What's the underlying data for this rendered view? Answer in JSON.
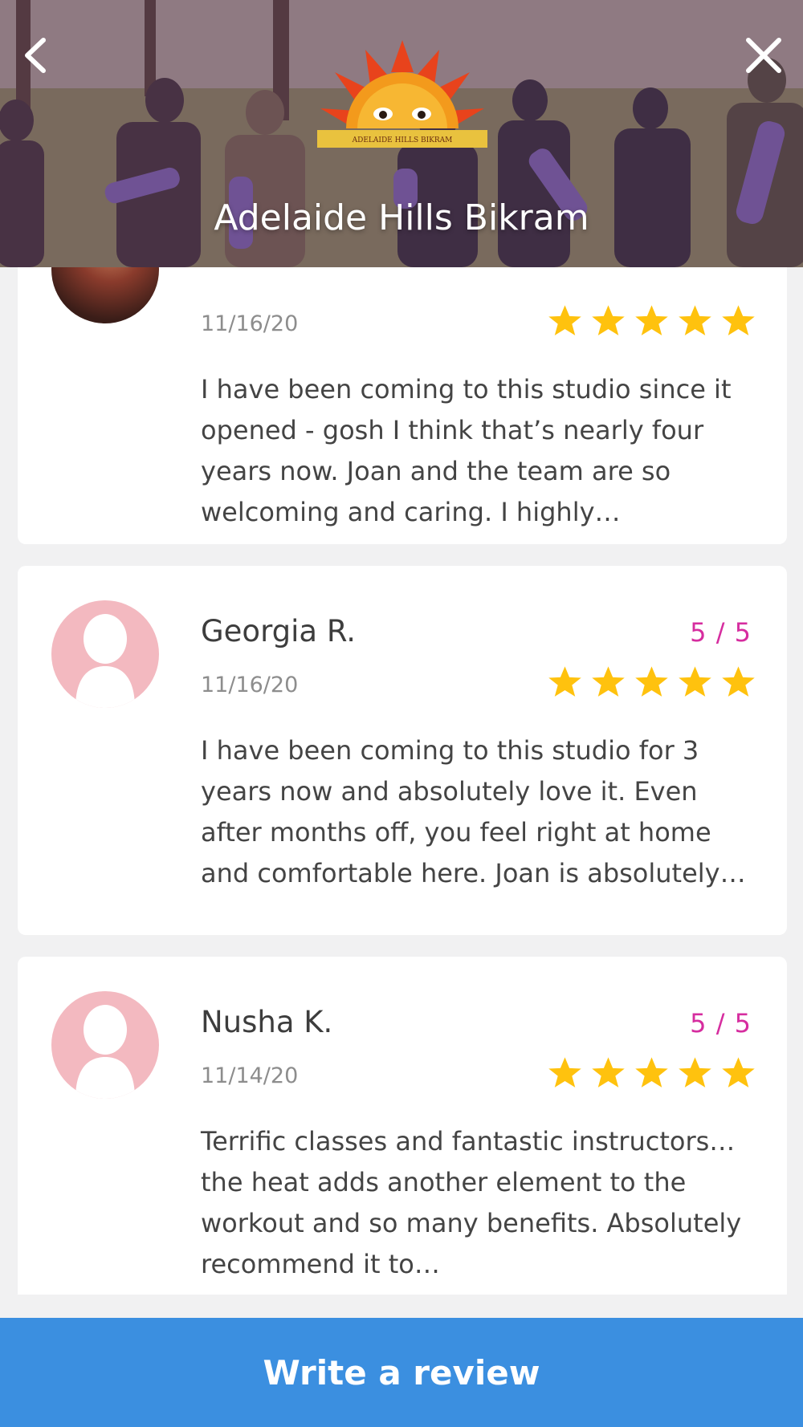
{
  "header": {
    "studio_name": "Adelaide Hills Bikram",
    "logo_banner_text": "ADELAIDE HILLS BIKRAM",
    "back_icon": "chevron-left-icon",
    "close_icon": "close-icon"
  },
  "reviews": [
    {
      "name": "",
      "rating": "",
      "date": "11/16/20",
      "stars": 5,
      "text": "I have been coming to this studio since it opened - gosh I think that’s nearly four years now. Joan and the team are so welcoming and caring. I highly…",
      "avatar": "photo"
    },
    {
      "name": "Georgia R.",
      "rating": "5 / 5",
      "date": "11/16/20",
      "stars": 5,
      "text": "I have been coming to this studio for 3 years now and absolutely love it. Even after months off, you feel right at home and comfortable here. Joan is absolutely…",
      "avatar": "placeholder"
    },
    {
      "name": "Nusha K.",
      "rating": "5 / 5",
      "date": "11/14/20",
      "stars": 5,
      "text": "Terrific classes and fantastic instructors…the heat adds another element to the workout and so many benefits. Absolutely recommend it to…",
      "avatar": "placeholder"
    }
  ],
  "footer": {
    "write_review_label": "Write a review"
  },
  "colors": {
    "accent_blue": "#3b8fe0",
    "rating_magenta": "#d62d9f",
    "star_yellow": "#ffc20e",
    "avatar_placeholder_pink": "#f3b9c0"
  }
}
